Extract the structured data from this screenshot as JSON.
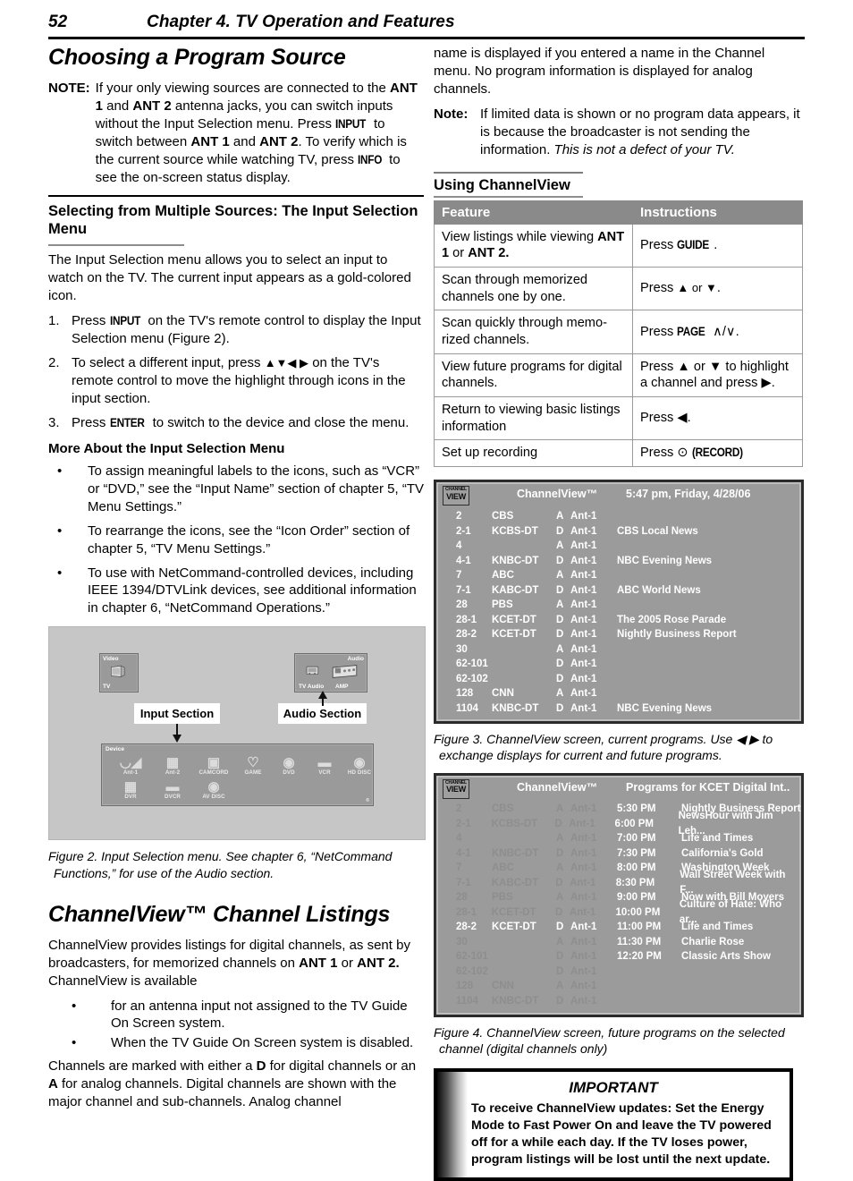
{
  "header": {
    "page_number": "52",
    "chapter_title": "Chapter 4. TV Operation and Features"
  },
  "left_column": {
    "section_title": "Choosing a Program Source",
    "note": {
      "label": "NOTE:",
      "text_1": "If your only viewing sources are connected to the ",
      "ant1": "ANT 1",
      "and_1": " and ",
      "ant2": "ANT 2",
      "text_2": " antenna jacks, you can switch inputs without the Input Selection menu.  Press ",
      "input_key": "INPUT",
      "text_3": " to switch between ",
      "ant1_b": "ANT 1",
      "and_2": " and ",
      "ant2_b": "ANT 2",
      "text_4": ".  To verify which is the current source while watching TV, press ",
      "info_key": "INFO",
      "text_5": " to see the on-screen status display."
    },
    "subsection_title": "Selecting from Multiple Sources:  The Input Selection Menu",
    "intro": "The Input Selection menu allows you to select an input to watch on the TV.  The current input appears as a gold-colored icon.",
    "steps": [
      {
        "num": "1.",
        "pre": "Press ",
        "key": "INPUT",
        "post": " on the TV's remote control to display the Input Selection menu (Figure 2)."
      },
      {
        "num": "2.",
        "pre": "To select a different input, press ",
        "key": "▲▼◀ ▶",
        "post": " on the TV's remote control to move the highlight through icons in the input section."
      },
      {
        "num": "3.",
        "pre": "Press ",
        "key": "ENTER",
        "post": " to switch to the device and close the menu."
      }
    ],
    "more_about_title": "More About the Input Selection Menu",
    "more_about_bullets": [
      "To assign meaningful labels to the icons, such as “VCR” or “DVD,” see the “Input Name” section of chapter 5, “TV Menu Settings.”",
      "To rearrange the icons, see the “Icon Order” section of chapter 5, “TV Menu Settings.”",
      "To use with NetCommand-controlled devices, including IEEE 1394/DTVLink devices, see additional information in chapter 6, “NetCommand Operations.”"
    ],
    "figure2": {
      "video_tile_label": "Video",
      "video_tile_item": "TV",
      "audio_tile_label": "Audio",
      "audio_items": [
        "TV Audio",
        "AMP"
      ],
      "device_tile_label": "Device",
      "device_items": [
        "Ant-1",
        "Ant-2",
        "CAMCORD",
        "GAME",
        "DVD",
        "VCR",
        "HD DISC",
        "DVR",
        "DVCR",
        "AV DISC"
      ],
      "callout_input": "Input Section",
      "callout_audio": "Audio Section",
      "caption": "Figure 2.  Input Selection menu.  See chapter 6, “NetCommand Functions,” for use of the Audio section."
    },
    "channelview_title": "ChannelView™ Channel Listings",
    "channelview_intro_1": "ChannelView provides listings for digital channels, as sent by broadcasters, for memorized channels on ",
    "channelview_ant1": "ANT 1",
    "channelview_or": " or ",
    "channelview_ant2": "ANT 2.",
    "channelview_intro_2": "  ChannelView is available",
    "channelview_bullets": [
      "for an antenna input not assigned to the TV Guide On Screen system.",
      "When the TV Guide On Screen system is disabled."
    ],
    "channelview_tail_1": "Channels are marked with either a ",
    "channelview_tail_d": "D",
    "channelview_tail_2": " for digital channels or an ",
    "channelview_tail_a": "A",
    "channelview_tail_3": " for analog channels.  Digital channels are shown with the major channel and sub-channels.  Analog channel"
  },
  "right_column": {
    "continuation": "name is displayed if you entered a name in the Channel menu.  No program information is displayed for analog channels.",
    "note": {
      "label": "Note:",
      "text": "If limited data is shown or no program data appears, it is because the broadcaster is not sending the information.  ",
      "italic": "This is not a defect of your TV."
    },
    "using_title": "Using ChannelView",
    "table": {
      "headers": [
        "Feature",
        "Instructions"
      ],
      "rows": [
        {
          "feature_pre": "View listings while viewing ",
          "feature_bold": "ANT 1",
          "feature_mid": " or ",
          "feature_bold2": "ANT 2.",
          "instruction_pre": "Press ",
          "instruction_key": "GUIDE",
          "instruction_post": "."
        },
        {
          "feature": "Scan through memorized channels one by one.",
          "instruction_pre": "Press ",
          "instruction_key": "▲ or ▼",
          "instruction_post": "."
        },
        {
          "feature": "Scan quickly through memo-rized channels.",
          "instruction_pre": "Press ",
          "instruction_key": "PAGE",
          "instruction_post": " ∧/∨."
        },
        {
          "feature": "View future programs for digital channels.",
          "instruction_pre": "Press ▲ or ▼ to highlight a channel and press ▶.",
          "instruction_key": "",
          "instruction_post": ""
        },
        {
          "feature": "Return to viewing  basic listings information",
          "instruction_pre": "Press ◀.",
          "instruction_key": "",
          "instruction_post": ""
        },
        {
          "feature": "Set up recording",
          "instruction_pre": "Press  ⊙ ",
          "instruction_key": "(RECORD)",
          "instruction_post": ""
        }
      ]
    },
    "figure3": {
      "logo_line1": "CHANNEL",
      "logo_line2": "VIEW",
      "title": "ChannelView™",
      "timestamp": "5:47 pm, Friday, 4/28/06",
      "rows": [
        {
          "ch": "2",
          "call": "CBS",
          "da": "A",
          "ant": "Ant-1",
          "prog": ""
        },
        {
          "ch": "2-1",
          "call": "KCBS-DT",
          "da": "D",
          "ant": "Ant-1",
          "prog": "CBS Local News"
        },
        {
          "ch": "4",
          "call": "",
          "da": "A",
          "ant": "Ant-1",
          "prog": ""
        },
        {
          "ch": "4-1",
          "call": "KNBC-DT",
          "da": "D",
          "ant": "Ant-1",
          "prog": "NBC Evening News"
        },
        {
          "ch": "7",
          "call": "ABC",
          "da": "A",
          "ant": "Ant-1",
          "prog": ""
        },
        {
          "ch": "7-1",
          "call": "KABC-DT",
          "da": "D",
          "ant": "Ant-1",
          "prog": "ABC World News"
        },
        {
          "ch": "28",
          "call": "PBS",
          "da": "A",
          "ant": "Ant-1",
          "prog": ""
        },
        {
          "ch": "28-1",
          "call": "KCET-DT",
          "da": "D",
          "ant": "Ant-1",
          "prog": "The 2005 Rose Parade"
        },
        {
          "ch": "28-2",
          "call": "KCET-DT",
          "da": "D",
          "ant": "Ant-1",
          "prog": "Nightly Business Report"
        },
        {
          "ch": "30",
          "call": "",
          "da": "A",
          "ant": "Ant-1",
          "prog": ""
        },
        {
          "ch": "62-101",
          "call": "",
          "da": "D",
          "ant": "Ant-1",
          "prog": ""
        },
        {
          "ch": "62-102",
          "call": "",
          "da": "D",
          "ant": "Ant-1",
          "prog": ""
        },
        {
          "ch": "128",
          "call": "CNN",
          "da": "A",
          "ant": "Ant-1",
          "prog": ""
        },
        {
          "ch": "1104",
          "call": "KNBC-DT",
          "da": "D",
          "ant": "Ant-1",
          "prog": "NBC Evening News"
        }
      ],
      "caption": "Figure 3. ChannelView screen, current programs.  Use ◀ ▶ to exchange displays for current and future programs."
    },
    "figure4": {
      "logo_line1": "CHANNEL",
      "logo_line2": "VIEW",
      "title": "ChannelView™",
      "subtitle": "Programs for KCET Digital Int..",
      "rows": [
        {
          "ch": "2",
          "call": "CBS",
          "da": "A",
          "ant": "Ant-1",
          "time": "5:30 PM",
          "prog": "Nightly Business Report",
          "selected": false
        },
        {
          "ch": "2-1",
          "call": "KCBS-DT",
          "da": "D",
          "ant": "Ant-1",
          "time": "6:00 PM",
          "prog": "NewsHour with Jim Leh...",
          "selected": false
        },
        {
          "ch": "4",
          "call": "",
          "da": "A",
          "ant": "Ant-1",
          "time": "7:00 PM",
          "prog": "Life and Times",
          "selected": false
        },
        {
          "ch": "4-1",
          "call": "KNBC-DT",
          "da": "D",
          "ant": "Ant-1",
          "time": "7:30 PM",
          "prog": "California's Gold",
          "selected": false
        },
        {
          "ch": "7",
          "call": "ABC",
          "da": "A",
          "ant": "Ant-1",
          "time": "8:00 PM",
          "prog": "Washington Week",
          "selected": false
        },
        {
          "ch": "7-1",
          "call": "KABC-DT",
          "da": "D",
          "ant": "Ant-1",
          "time": "8:30 PM",
          "prog": "Wall Street Week with F...",
          "selected": false
        },
        {
          "ch": "28",
          "call": "PBS",
          "da": "A",
          "ant": "Ant-1",
          "time": "9:00 PM",
          "prog": "Now with Bill Moyers",
          "selected": false
        },
        {
          "ch": "28-1",
          "call": "KCET-DT",
          "da": "D",
          "ant": "Ant-1",
          "time": "10:00 PM",
          "prog": "Culture of Hate: Who ar...",
          "selected": false
        },
        {
          "ch": "28-2",
          "call": "KCET-DT",
          "da": "D",
          "ant": "Ant-1",
          "time": "11:00 PM",
          "prog": "Life and Times",
          "selected": true
        },
        {
          "ch": "30",
          "call": "",
          "da": "A",
          "ant": "Ant-1",
          "time": "11:30 PM",
          "prog": "Charlie Rose",
          "selected": false
        },
        {
          "ch": "62-101",
          "call": "",
          "da": "D",
          "ant": "Ant-1",
          "time": "12:20 PM",
          "prog": "Classic Arts Show",
          "selected": false
        },
        {
          "ch": "62-102",
          "call": "",
          "da": "D",
          "ant": "Ant-1",
          "time": "",
          "prog": "",
          "selected": false
        },
        {
          "ch": "128",
          "call": "CNN",
          "da": "A",
          "ant": "Ant-1",
          "time": "",
          "prog": "",
          "selected": false
        },
        {
          "ch": "1104",
          "call": "KNBC-DT",
          "da": "D",
          "ant": "Ant-1",
          "time": "",
          "prog": "",
          "selected": false
        }
      ],
      "caption": "Figure 4. ChannelView screen, future programs on the selected channel (digital channels only)"
    },
    "important": {
      "title": "IMPORTANT",
      "body": "To receive ChannelView updates:   Set the Energy Mode to Fast Power On and leave the TV powered off for a while each day.   If the TV loses power, program listings will be lost until the next update."
    }
  },
  "colors": {
    "table_header_bg": "#8a8a8a",
    "figure_bg": "#c6c6c6",
    "tv_screen_bg": "#9b9b9b",
    "tile_bg": "#9a9a9a"
  }
}
